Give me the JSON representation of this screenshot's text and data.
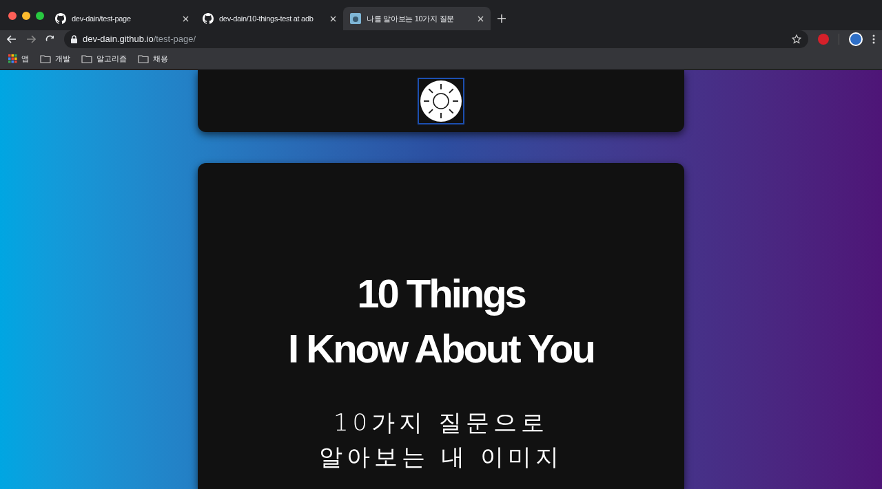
{
  "tabs": [
    {
      "title": "dev-dain/test-page",
      "selected": false,
      "kind": "github"
    },
    {
      "title": "dev-dain/10-things-test at adb",
      "selected": false,
      "kind": "github"
    },
    {
      "title": "나를 알아보는 10가지 질문",
      "selected": true,
      "kind": "site"
    }
  ],
  "address": {
    "host": "dev-dain.github.io",
    "path": "/test-page/"
  },
  "bookmarks": [
    {
      "label": "앱",
      "kind": "apps"
    },
    {
      "label": "개발",
      "kind": "folder"
    },
    {
      "label": "알고리즘",
      "kind": "folder"
    },
    {
      "label": "채용",
      "kind": "folder"
    }
  ],
  "page": {
    "title_lines": [
      "10 Things",
      "I Know About You"
    ],
    "subtitle_lines": [
      "10가지 질문으로",
      "알아보는 내 이미지"
    ]
  }
}
